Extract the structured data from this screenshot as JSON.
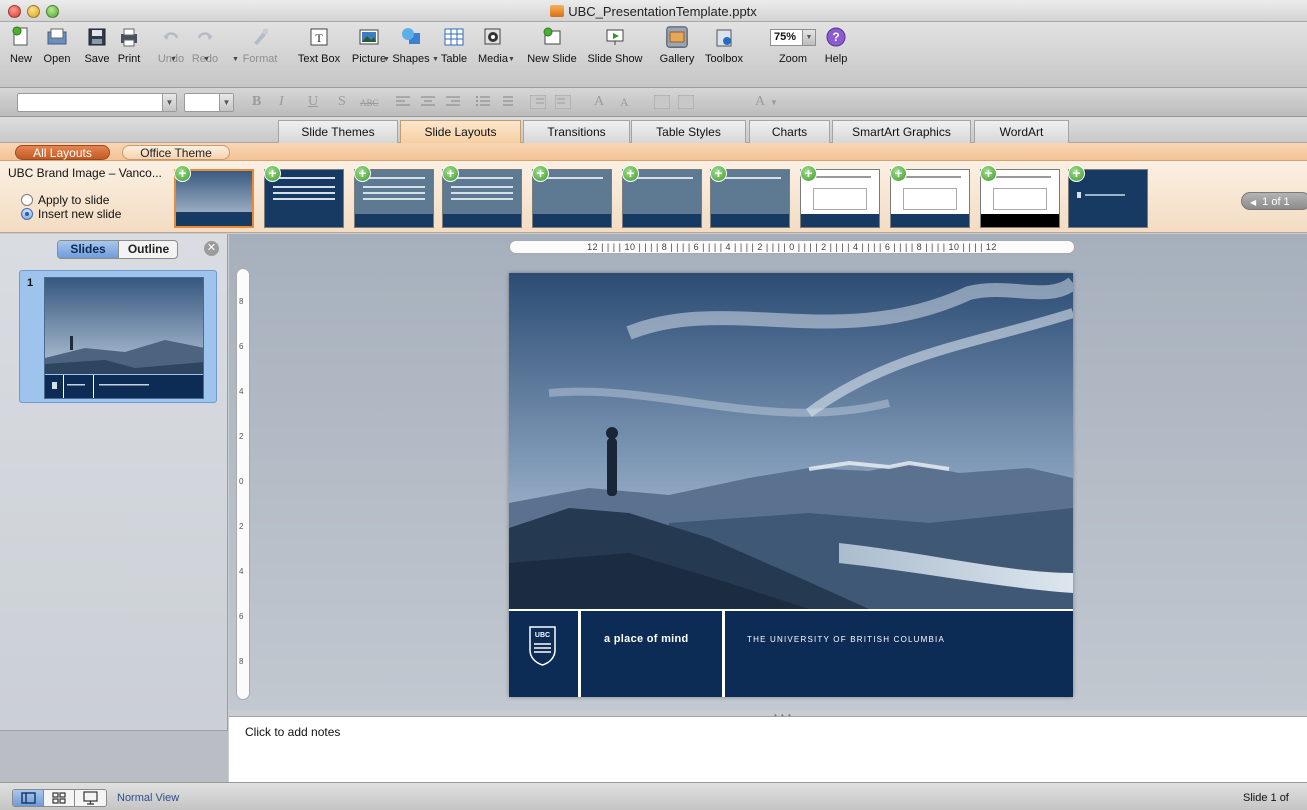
{
  "window": {
    "title": "UBC_PresentationTemplate.pptx"
  },
  "toolbar": {
    "items": [
      {
        "label": "New",
        "icon": "new-document-icon",
        "enabled": true
      },
      {
        "label": "Open",
        "icon": "open-folder-icon",
        "enabled": true
      },
      {
        "label": "Save",
        "icon": "floppy-disk-icon",
        "enabled": true
      },
      {
        "label": "Print",
        "icon": "printer-icon",
        "enabled": true
      },
      {
        "label": "Undo",
        "icon": "undo-arrow-icon",
        "enabled": false
      },
      {
        "label": "Redo",
        "icon": "redo-arrow-icon",
        "enabled": false
      },
      {
        "label": "Format",
        "icon": "paintbrush-icon",
        "enabled": false
      },
      {
        "label": "Text Box",
        "icon": "text-box-icon",
        "enabled": true
      },
      {
        "label": "Picture",
        "icon": "picture-icon",
        "enabled": true
      },
      {
        "label": "Shapes",
        "icon": "shapes-icon",
        "enabled": true
      },
      {
        "label": "Table",
        "icon": "table-grid-icon",
        "enabled": true
      },
      {
        "label": "Media",
        "icon": "media-icon",
        "enabled": true
      },
      {
        "label": "New Slide",
        "icon": "new-slide-icon",
        "enabled": true
      },
      {
        "label": "Slide Show",
        "icon": "slide-show-icon",
        "enabled": true
      },
      {
        "label": "Gallery",
        "icon": "gallery-icon",
        "enabled": true,
        "active": true
      },
      {
        "label": "Toolbox",
        "icon": "toolbox-icon",
        "enabled": true
      },
      {
        "label": "Zoom",
        "icon": "zoom-icon",
        "enabled": true
      },
      {
        "label": "Help",
        "icon": "help-icon",
        "enabled": true
      }
    ],
    "zoom_value": "75%"
  },
  "format_bar": {
    "glyphs": [
      "B",
      "I",
      "U",
      "S",
      "ABC",
      "A",
      "A",
      "A"
    ]
  },
  "ribbon_tabs": [
    {
      "label": "Slide Themes",
      "active": false
    },
    {
      "label": "Slide Layouts",
      "active": true
    },
    {
      "label": "Transitions",
      "active": false
    },
    {
      "label": "Table Styles",
      "active": false
    },
    {
      "label": "Charts",
      "active": false
    },
    {
      "label": "SmartArt Graphics",
      "active": false
    },
    {
      "label": "WordArt",
      "active": false
    }
  ],
  "gallery": {
    "filter_all": "All Layouts",
    "filter_theme": "Office Theme",
    "title": "UBC Brand Image – Vanco...",
    "apply_option": "Apply to slide",
    "insert_option": "Insert new slide",
    "selected_option": "insert",
    "page_indicator": "1 of 1",
    "layout_count": 11
  },
  "left_pane": {
    "tab_slides": "Slides",
    "tab_outline": "Outline",
    "slide_number": "1"
  },
  "ruler": {
    "horizontal": "12 | | | | 10 | | | | 8 | | | | 6 | | | | 4 | | | | 2 | | | | 0 | | | | 2 | | | | 4 | | | | 6 | | | | 8 | | | | 10 | | | | 12",
    "vertical_ticks": [
      "8",
      "6",
      "4",
      "2",
      "0",
      "2",
      "4",
      "6",
      "8"
    ]
  },
  "slide": {
    "tagline": "a place of mind",
    "university": "THE UNIVERSITY OF BRITISH COLUMBIA",
    "logo_text": "UBC",
    "brand_color": "#0c2c55"
  },
  "notes": {
    "placeholder": "Click to add notes"
  },
  "status": {
    "view_name": "Normal View",
    "slide_count": "Slide 1 of"
  },
  "colors": {
    "accent_orange": "#e98a3a",
    "selection_blue": "#6e9bd8"
  }
}
